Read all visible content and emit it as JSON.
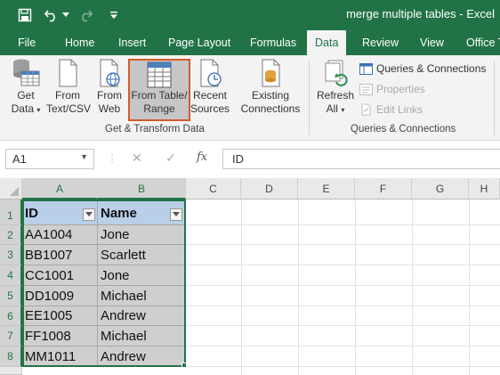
{
  "titlebar": {
    "title": "merge multiple tables  -  Excel"
  },
  "tabs": [
    "File",
    "Home",
    "Insert",
    "Page Layout",
    "Formulas",
    "Data",
    "Review",
    "View",
    "Office T"
  ],
  "ribbon": {
    "get_data": {
      "line1": "Get",
      "line2": "Data"
    },
    "from_text": {
      "line1": "From",
      "line2": "Text/CSV"
    },
    "from_web": {
      "line1": "From",
      "line2": "Web"
    },
    "from_table": {
      "line1": "From Table/",
      "line2": "Range"
    },
    "recent_sources": {
      "line1": "Recent",
      "line2": "Sources"
    },
    "existing_connections": {
      "line1": "Existing",
      "line2": "Connections"
    },
    "group1_label": "Get & Transform Data",
    "refresh_all": {
      "line1": "Refresh",
      "line2": "All"
    },
    "queries_connections": "Queries & Connections",
    "properties": "Properties",
    "edit_links": "Edit Links",
    "group2_label": "Queries & Connections"
  },
  "formula_bar": {
    "name_box": "A1",
    "cancel": "✕",
    "enter": "✓",
    "fx": "fx",
    "value": "ID"
  },
  "grid": {
    "columns": [
      "A",
      "B",
      "C",
      "D",
      "E",
      "F",
      "G",
      "H"
    ],
    "rows": [
      "1",
      "2",
      "3",
      "4",
      "5",
      "6",
      "7",
      "8"
    ],
    "headers": [
      "ID",
      "Name"
    ],
    "data": [
      [
        "AA1004",
        "Jone"
      ],
      [
        "BB1007",
        "Scarlett"
      ],
      [
        "CC1001",
        "Jone"
      ],
      [
        "DD1009",
        "Michael"
      ],
      [
        "EE1005",
        "Andrew"
      ],
      [
        "FF1008",
        "Michael"
      ],
      [
        "MM1011",
        "Andrew"
      ]
    ]
  },
  "colors": {
    "excel_green": "#217346",
    "header_fill": "#b9cfe8",
    "cell_fill": "#cfcfcf",
    "selected_border": "#d25b2a"
  }
}
